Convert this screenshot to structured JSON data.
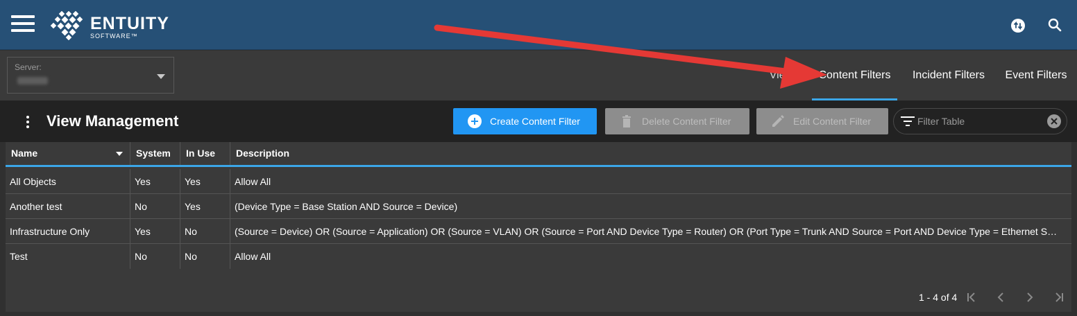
{
  "header": {
    "brand_name": "ENTUITY",
    "brand_sub": "SOFTWARE™",
    "menu_icon": "hamburger-icon",
    "sync_icon": "sync-icon",
    "search_icon": "search-icon",
    "brand_color": "#265076"
  },
  "server": {
    "label": "Server:"
  },
  "tabs": [
    {
      "label": "Views",
      "active": false
    },
    {
      "label": "Content Filters",
      "active": true
    },
    {
      "label": "Incident Filters",
      "active": false
    },
    {
      "label": "Event Filters",
      "active": false
    }
  ],
  "toolbar": {
    "title": "View Management",
    "create_label": "Create Content Filter",
    "delete_label": "Delete Content Filter",
    "edit_label": "Edit Content Filter",
    "filter_placeholder": "Filter Table",
    "accent_color": "#2196f3"
  },
  "table": {
    "columns": [
      "Name",
      "System",
      "In Use",
      "Description"
    ],
    "rows": [
      {
        "name": "All Objects",
        "system": "Yes",
        "in_use": "Yes",
        "description": "Allow All"
      },
      {
        "name": "Another test",
        "system": "No",
        "in_use": "Yes",
        "description": "(Device Type = Base Station AND Source = Device)"
      },
      {
        "name": "Infrastructure Only",
        "system": "Yes",
        "in_use": "No",
        "description": "(Source = Device) OR (Source = Application) OR (Source = VLAN) OR (Source = Port AND Device Type = Router) OR (Port Type = Trunk AND Source = Port AND Device Type = Ethernet Switch)"
      },
      {
        "name": "Test",
        "system": "No",
        "in_use": "No",
        "description": "Allow All"
      }
    ]
  },
  "pagination": {
    "range_text": "1 - 4 of 4"
  },
  "annotation": {
    "arrow_color": "#e53935"
  }
}
